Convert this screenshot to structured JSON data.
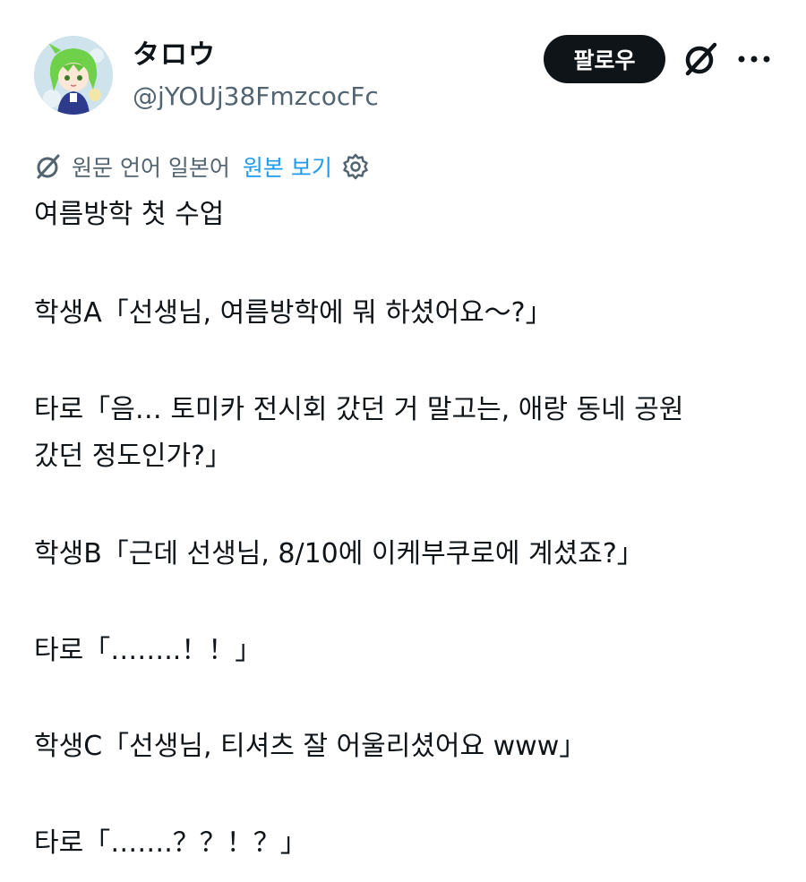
{
  "header": {
    "display_name": "タロウ",
    "handle": "@jYOUj38FmzcocFc",
    "follow_label": "팔로우",
    "icons": [
      "avatar",
      "grok-icon",
      "more-icon"
    ]
  },
  "translation": {
    "original_language": "원문 언어 일본어",
    "view_original": "원본 보기",
    "icons": [
      "translate-slash-icon",
      "gear-icon"
    ],
    "link_color": "#1d9bf0"
  },
  "body": {
    "lines": [
      "여름방학 첫 수업",
      "학생A「선생님, 여름방학에 뭐 하셨어요～?」",
      "타로「음… 토미카 전시회 갔던 거 말고는, 애랑 동네 공원",
      "갔던 정도인가?」",
      "학생B「근데 선생님, 8/10에 이케부쿠로에 계셨죠?」",
      "타로「……..！！」",
      "학생C「선생님, 티셔츠 잘 어울리셨어요 www」",
      "타로「…….？？！？」"
    ]
  },
  "colors": {
    "text": "#0f1419",
    "secondary": "#536471",
    "button_bg": "#0f1419",
    "button_text": "#ffffff"
  }
}
